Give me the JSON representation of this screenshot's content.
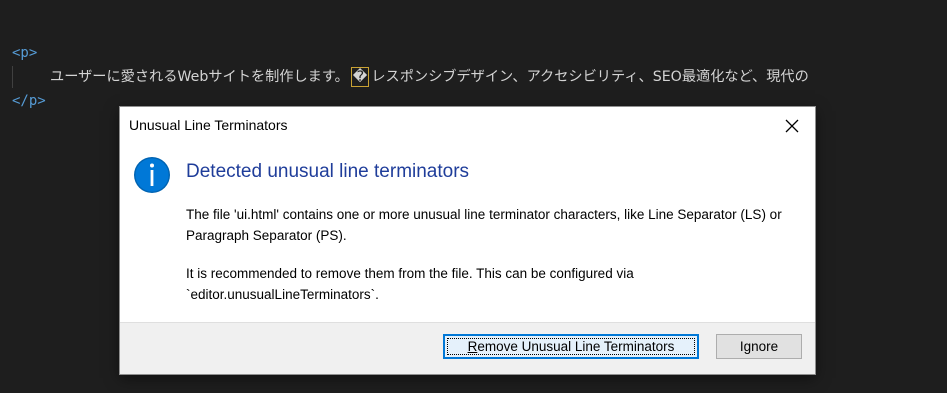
{
  "editor": {
    "open_tag": "<p>",
    "close_tag": "</p>",
    "text_before": "ユーザーに愛されるWebサイトを制作します。",
    "unusual_char": "�",
    "text_after": "レスポンシブデザイン、アクセシビリティ、SEO最適化など、現代の"
  },
  "dialog": {
    "title": "Unusual Line Terminators",
    "main_instruction": "Detected unusual line terminators",
    "content_1": "The file 'ui.html' contains one or more unusual line terminator characters, like Line Separator (LS) or Paragraph Separator (PS).",
    "content_2": "It is recommended to remove them from the file. This can be configured via `editor.unusualLineTerminators`.",
    "remove_button": {
      "accel": "R",
      "rest": "emove Unusual Line Terminators"
    },
    "ignore_button": "Ignore",
    "icons": {
      "info": "info-icon",
      "close": "close-icon"
    },
    "colors": {
      "accent": "#0078d7",
      "instruction": "#1f3d9a",
      "info_icon": "#0063b1"
    }
  }
}
